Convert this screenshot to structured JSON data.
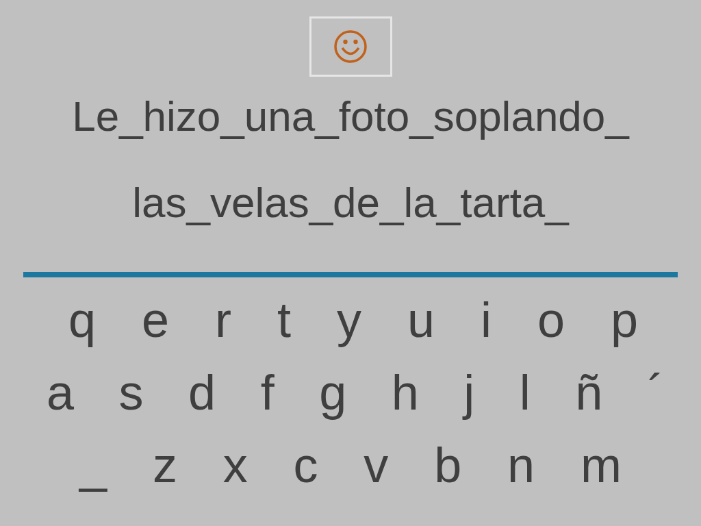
{
  "sentence": [
    "Le_hizo_una_foto_soplando_",
    "las_velas_de_la_tarta_"
  ],
  "keyboard": {
    "rows": [
      [
        "q",
        "e",
        "r",
        "t",
        "y",
        "u",
        "i",
        "o",
        "p"
      ],
      [
        "a",
        "s",
        "d",
        "f",
        "g",
        "h",
        "j",
        "l",
        "ñ",
        "´"
      ],
      [
        "_",
        "z",
        "x",
        "c",
        "v",
        "b",
        "n",
        "m"
      ]
    ]
  }
}
